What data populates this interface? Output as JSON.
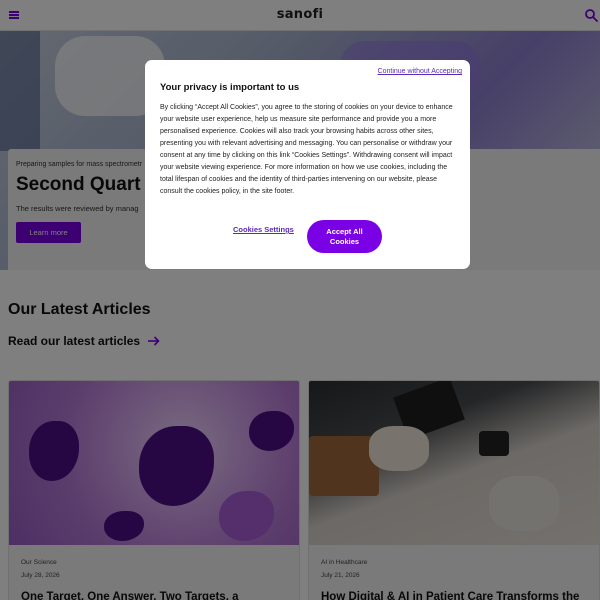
{
  "header": {
    "logo": "sanofi",
    "menu_icon": "hamburger-icon",
    "search_icon": "search-icon"
  },
  "hero": {
    "eyebrow": "Preparing samples for mass spectrometr",
    "title": "Second Quart",
    "description": "The results were reviewed by manag",
    "button_label": "Learn more"
  },
  "articles": {
    "section_title": "Our Latest Articles",
    "read_link": "Read our latest articles",
    "cards": [
      {
        "category": "Our Science",
        "date": "July 28, 2026",
        "title": "One Target, One Answer, Two Targets, a"
      },
      {
        "category": "AI in Healthcare",
        "date": "July 21, 2026",
        "title": "How Digital & AI in Patient Care Transforms the"
      }
    ]
  },
  "cookie_modal": {
    "continue_link": "Continue without Accepting",
    "title": "Your privacy is important to us",
    "body": "By clicking “Accept All Cookies”, you agree to the storing of cookies on your device to enhance your website user experience, help us measure site performance and provide you a more personalised experience. Cookies will also track your browsing habits across other sites, presenting you with relevant advertising and messaging. You can personalise or withdraw your consent at any time by clicking on this link “Cookies Settings”. Withdrawing consent will impact your website viewing experience. For more information on how we use cookies, including the total lifespan of cookies and the identity of third-parties intervening on our website, please consult the cookies policy, in the site footer.",
    "settings_label": "Cookies Settings",
    "accept_label": "Accept All Cookies"
  },
  "colors": {
    "accent": "#7a00e6",
    "link": "#5a2bb8"
  }
}
